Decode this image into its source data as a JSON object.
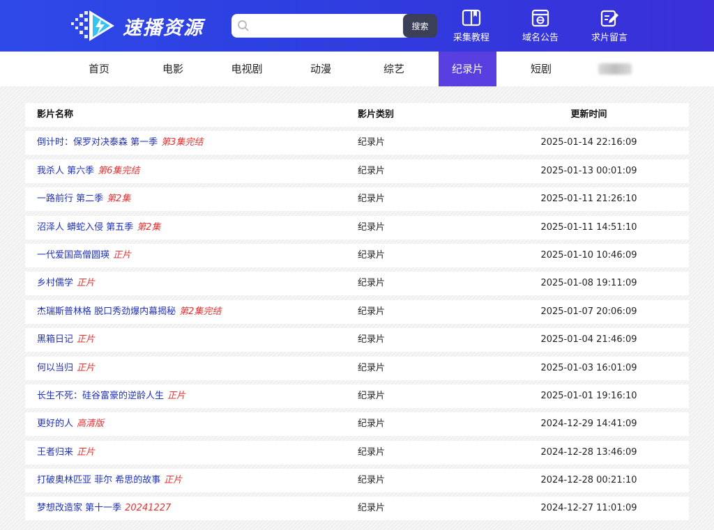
{
  "brand": {
    "name": "速播资源"
  },
  "search": {
    "placeholder": "",
    "button_label": "搜索"
  },
  "header_links": [
    {
      "label": "采集教程",
      "icon": "book-icon"
    },
    {
      "label": "域名公告",
      "icon": "notice-icon"
    },
    {
      "label": "求片留言",
      "icon": "edit-icon"
    }
  ],
  "nav": {
    "items": [
      {
        "label": "首页"
      },
      {
        "label": "电影"
      },
      {
        "label": "电视剧"
      },
      {
        "label": "动漫"
      },
      {
        "label": "综艺"
      },
      {
        "label": "纪录片",
        "active": true
      },
      {
        "label": "短剧"
      }
    ]
  },
  "table": {
    "headers": [
      "影片名称",
      "影片类别",
      "更新时间"
    ],
    "rows": [
      {
        "title": "倒计时：保罗对决泰森 第一季",
        "status": "第3集完结",
        "category": "纪录片",
        "time": "2025-01-14 22:16:09"
      },
      {
        "title": "我杀人 第六季",
        "status": "第6集完结",
        "category": "纪录片",
        "time": "2025-01-13 00:01:09"
      },
      {
        "title": "一路前行 第二季",
        "status": "第2集",
        "category": "纪录片",
        "time": "2025-01-11 21:26:10"
      },
      {
        "title": "沼泽人 蟒蛇入侵 第五季",
        "status": "第2集",
        "category": "纪录片",
        "time": "2025-01-11 14:51:10"
      },
      {
        "title": "一代爱国高僧圆瑛",
        "status": "正片",
        "category": "纪录片",
        "time": "2025-01-10 10:46:09"
      },
      {
        "title": "乡村儒学",
        "status": "正片",
        "category": "纪录片",
        "time": "2025-01-08 19:11:09"
      },
      {
        "title": "杰瑞斯普林格 脱口秀劲爆内幕揭秘",
        "status": "第2集完结",
        "category": "纪录片",
        "time": "2025-01-07 20:06:09"
      },
      {
        "title": "黑箱日记",
        "status": "正片",
        "category": "纪录片",
        "time": "2025-01-04 21:46:09"
      },
      {
        "title": "何以当归",
        "status": "正片",
        "category": "纪录片",
        "time": "2025-01-03 16:01:09"
      },
      {
        "title": "长生不死：硅谷富豪的逆龄人生",
        "status": "正片",
        "category": "纪录片",
        "time": "2025-01-01 19:16:10"
      },
      {
        "title": "更好的人",
        "status": "高清版",
        "category": "纪录片",
        "time": "2024-12-29 14:41:09"
      },
      {
        "title": "王者归来",
        "status": "正片",
        "category": "纪录片",
        "time": "2024-12-28 13:46:09"
      },
      {
        "title": "打破奥林匹亚 菲尔 希思的故事",
        "status": "正片",
        "category": "纪录片",
        "time": "2024-12-28 00:21:10"
      },
      {
        "title": "梦想改造家 第十一季",
        "status": "20241227",
        "category": "纪录片",
        "time": "2024-12-27 11:01:09"
      }
    ]
  }
}
